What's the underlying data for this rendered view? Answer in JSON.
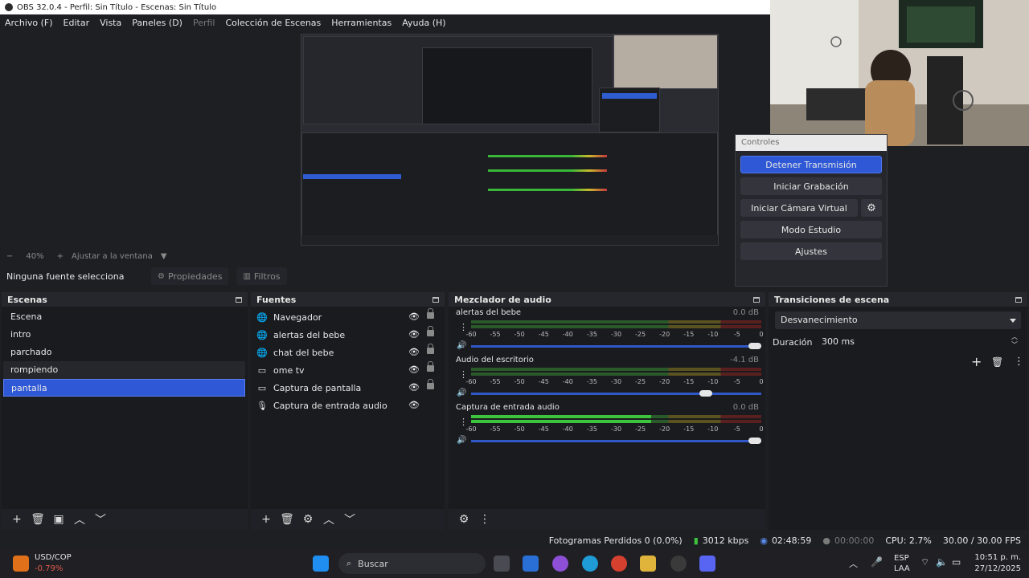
{
  "window": {
    "title": "OBS 32.0.4 - Perfil: Sin Título - Escenas: Sin Título"
  },
  "menu": [
    {
      "label": "Archivo (F)",
      "enabled": true
    },
    {
      "label": "Editar",
      "enabled": true
    },
    {
      "label": "Vista",
      "enabled": true
    },
    {
      "label": "Paneles (D)",
      "enabled": true
    },
    {
      "label": "Perfil",
      "enabled": false
    },
    {
      "label": "Colección de Escenas",
      "enabled": true
    },
    {
      "label": "Herramientas",
      "enabled": true
    },
    {
      "label": "Ayuda (H)",
      "enabled": true
    }
  ],
  "preview": {
    "zoom": "40%",
    "fit_label": "Ajustar a la ventana"
  },
  "controls": {
    "title": "Controles",
    "buttons": [
      "Detener Transmisión",
      "Iniciar Grabación",
      "Iniciar Cámara Virtual",
      "Modo Estudio",
      "Ajustes"
    ]
  },
  "source_toolbar": {
    "selected": "Ninguna fuente selecciona",
    "properties": "Propiedades",
    "filters": "Filtros"
  },
  "scenes": {
    "title": "Escenas",
    "items": [
      "Escena",
      "intro",
      "parchado",
      "rompiendo",
      "pantalla"
    ],
    "selected_index": 4
  },
  "sources": {
    "title": "Fuentes",
    "items": [
      {
        "name": "Navegador",
        "icon": "browser-icon"
      },
      {
        "name": "alertas del bebe",
        "icon": "browser-icon"
      },
      {
        "name": "chat del bebe",
        "icon": "browser-icon"
      },
      {
        "name": "ome tv",
        "icon": "window-icon"
      },
      {
        "name": "Captura de pantalla",
        "icon": "monitor-icon"
      },
      {
        "name": "Captura de entrada audio",
        "icon": "microphone-icon"
      }
    ]
  },
  "mixer": {
    "title": "Mezclador de audio",
    "scale": [
      "-60",
      "-55",
      "-50",
      "-45",
      "-40",
      "-35",
      "-30",
      "-25",
      "-20",
      "-15",
      "-10",
      "-5",
      "0"
    ],
    "channels": [
      {
        "name": "alertas del bebe",
        "db": "0.0 dB",
        "level": 0.0,
        "volume": 1.0
      },
      {
        "name": "Audio del escritorio",
        "db": "-4.1 dB",
        "level": 0.0,
        "volume": 0.83
      },
      {
        "name": "Captura de entrada audio",
        "db": "0.0 dB",
        "level": 0.62,
        "volume": 1.0
      }
    ]
  },
  "transitions": {
    "title": "Transiciones de escena",
    "type": "Desvanecimiento",
    "duration_label": "Duración",
    "duration": "300 ms"
  },
  "status": {
    "dropped": "Fotogramas Perdidos 0 (0.0%)",
    "bitrate": "3012 kbps",
    "stream_time": "02:48:59",
    "rec_time": "00:00:00",
    "cpu": "CPU: 2.7%",
    "fps": "30.00 / 30.00 FPS"
  },
  "taskbar": {
    "widget_name": "USD/COP",
    "widget_change": "-0.79%",
    "search_placeholder": "Buscar",
    "lang": "ESP",
    "lang2": "LAA",
    "time": "10:51 p. m.",
    "date": "27/12/2025"
  },
  "colors": {
    "accent": "#2e58d6",
    "panel": "#1a1b1f",
    "meter_green": "#3cc43c"
  }
}
